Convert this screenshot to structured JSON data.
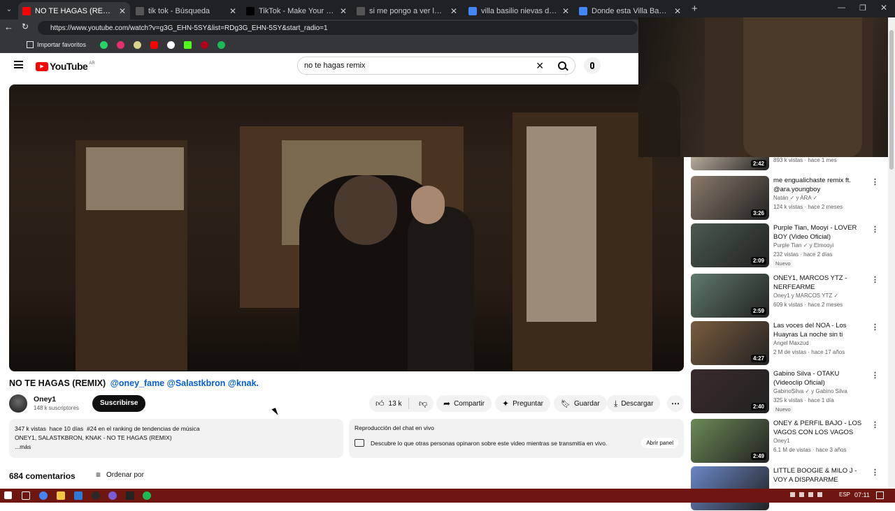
{
  "browser": {
    "tabs": [
      {
        "title": "NO TE HAGAS (REMIX) @oney",
        "active": true,
        "icon_color": "#ff0000"
      },
      {
        "title": "tik tok - Búsqueda",
        "active": false,
        "icon_color": "#555555"
      },
      {
        "title": "TikTok - Make Your Day",
        "active": false,
        "icon_color": "#000000"
      },
      {
        "title": "si me pongo a ver los simpson en",
        "active": false,
        "icon_color": "#555555"
      },
      {
        "title": "villa basilio nievas duendes - Búsq",
        "active": false,
        "icon_color": "#4285f4"
      },
      {
        "title": "Donde esta Villa Basilio Nievas Zo",
        "active": false,
        "icon_color": "#4285f4"
      }
    ],
    "url": "https://www.youtube.com/watch?v=g3G_EHN-5SY&list=RDg3G_EHN-5SY&start_radio=1",
    "bookmarks_label": "Importar favoritos"
  },
  "youtube": {
    "logo_text": "YouTube",
    "region": "AR",
    "search_value": "no te hagas remix",
    "video": {
      "title_plain": "NO TE HAGAS (REMIX)",
      "title_tags": "@oney_fame @Salastkbron @knak.",
      "channel": "Oney1",
      "subscribers": "148 k suscriptores",
      "subscribe_label": "Suscribirse",
      "likes": "13 k",
      "share_label": "Compartir",
      "ask_label": "Preguntar",
      "save_label": "Guardar",
      "download_label": "Descargar",
      "stats": "347 k vistas  hace 10 días  #24 en el ranking de tendencias de música",
      "desc_line": "ONEY1, SALASTKBRON, KNAK - NO TE HAGAS (REMIX)",
      "more": "...más",
      "chat_title": "Reproducción del chat en vivo",
      "chat_desc": "Descubre lo que otras personas opinaron sobre este video mientras se transmitía en vivo.",
      "chat_button": "Abrir panel",
      "comments_count": "684 comentarios",
      "sort_label": "Ordenar por"
    },
    "recommendations": [
      {
        "title": "",
        "author": "",
        "meta": "893 k vistas · hace 1 mes",
        "duration": "2:42",
        "badge": "",
        "thumb": "#b7aa98"
      },
      {
        "title": "me engualichaste remix ft. @ara.youngboy",
        "author": "Natán ✓ y ARA ✓",
        "meta": "124 k vistas · hace 2 meses",
        "duration": "3:26",
        "badge": "",
        "thumb": "#8a7a6a"
      },
      {
        "title": "Purple Tian, Mooyi - LOVER BOY (Video Oficial)",
        "author": "Purple Tian ✓ y Elmooyi",
        "meta": "232 vistas · hace 2 días",
        "duration": "2:09",
        "badge": "Nuevo",
        "thumb": "#4a5a4e"
      },
      {
        "title": "ONEY1, MARCOS YTZ - NERFEARME",
        "author": "Oney1 y MARCOS YTZ ✓",
        "meta": "609 k vistas · hace 2 meses",
        "duration": "2:59",
        "badge": "",
        "thumb": "#5f7a6a"
      },
      {
        "title": "Las voces del NOA - Los Huayras   La noche sin ti",
        "author": "Angel Maxzud",
        "meta": "2 M de vistas · hace 17 años",
        "duration": "4:27",
        "badge": "",
        "thumb": "#7a5c3e"
      },
      {
        "title": "Gabino Silva - OTAKU (Videoclip Oficial)",
        "author": "GabinoSilva ✓ y Gabino Silva",
        "meta": "325 k vistas · hace 1 día",
        "duration": "2:40",
        "badge": "Nuevo",
        "thumb": "#3a2a2a"
      },
      {
        "title": "ONEY & PERFIL BAJO - LOS VAGOS CON LOS VAGOS",
        "author": "Oney1",
        "meta": "6.1 M de vistas · hace 3 años",
        "duration": "2:49",
        "badge": "",
        "thumb": "#6b8a56"
      },
      {
        "title": "LITTLE BOOGIE & MILO J - VOY A DISPARARME (VIDEOCLIP ...",
        "author": "",
        "meta": "",
        "duration": "",
        "badge": "",
        "thumb": "#6a88c8"
      }
    ]
  },
  "taskbar": {
    "time": "07:11",
    "lang": "ESP"
  }
}
